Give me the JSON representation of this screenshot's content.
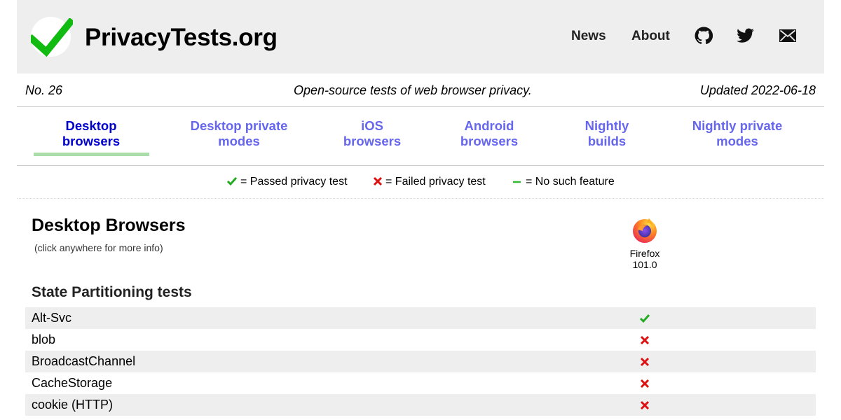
{
  "header": {
    "site_title": "PrivacyTests.org",
    "nav": [
      {
        "label": "News"
      },
      {
        "label": "About"
      }
    ],
    "icons": [
      "github-icon",
      "twitter-icon",
      "mail-icon"
    ]
  },
  "subhead": {
    "issue": "No. 26",
    "tagline": "Open-source tests of web browser privacy.",
    "updated": "Updated 2022-06-18"
  },
  "tabs": [
    {
      "line1": "Desktop",
      "line2": "browsers",
      "active": true
    },
    {
      "line1": "Desktop private",
      "line2": "modes",
      "active": false
    },
    {
      "line1": "iOS",
      "line2": "browsers",
      "active": false
    },
    {
      "line1": "Android",
      "line2": "browsers",
      "active": false
    },
    {
      "line1": "Nightly",
      "line2": "builds",
      "active": false
    },
    {
      "line1": "Nightly private",
      "line2": "modes",
      "active": false
    }
  ],
  "legend": {
    "passed": "= Passed privacy test",
    "failed": "= Failed privacy test",
    "none": "= No such feature"
  },
  "section": {
    "title": "Desktop Browsers",
    "hint": "(click anywhere for more info)"
  },
  "browser": {
    "name": "Firefox",
    "version": "101.0",
    "icon": "firefox-logo-icon"
  },
  "group": {
    "title": "State Partitioning tests"
  },
  "rows": [
    {
      "label": "Alt-Svc",
      "result": "pass"
    },
    {
      "label": "blob",
      "result": "fail"
    },
    {
      "label": "BroadcastChannel",
      "result": "fail"
    },
    {
      "label": "CacheStorage",
      "result": "fail"
    },
    {
      "label": "cookie (HTTP)",
      "result": "fail"
    }
  ],
  "colors": {
    "pass": "#22aa22",
    "fail": "#dd1111",
    "none": "#33bb33",
    "tab_active": "#0000cc",
    "tab_inactive": "#6666ee",
    "tab_underline": "#aaddaa",
    "header_bg": "#eeeeee"
  }
}
